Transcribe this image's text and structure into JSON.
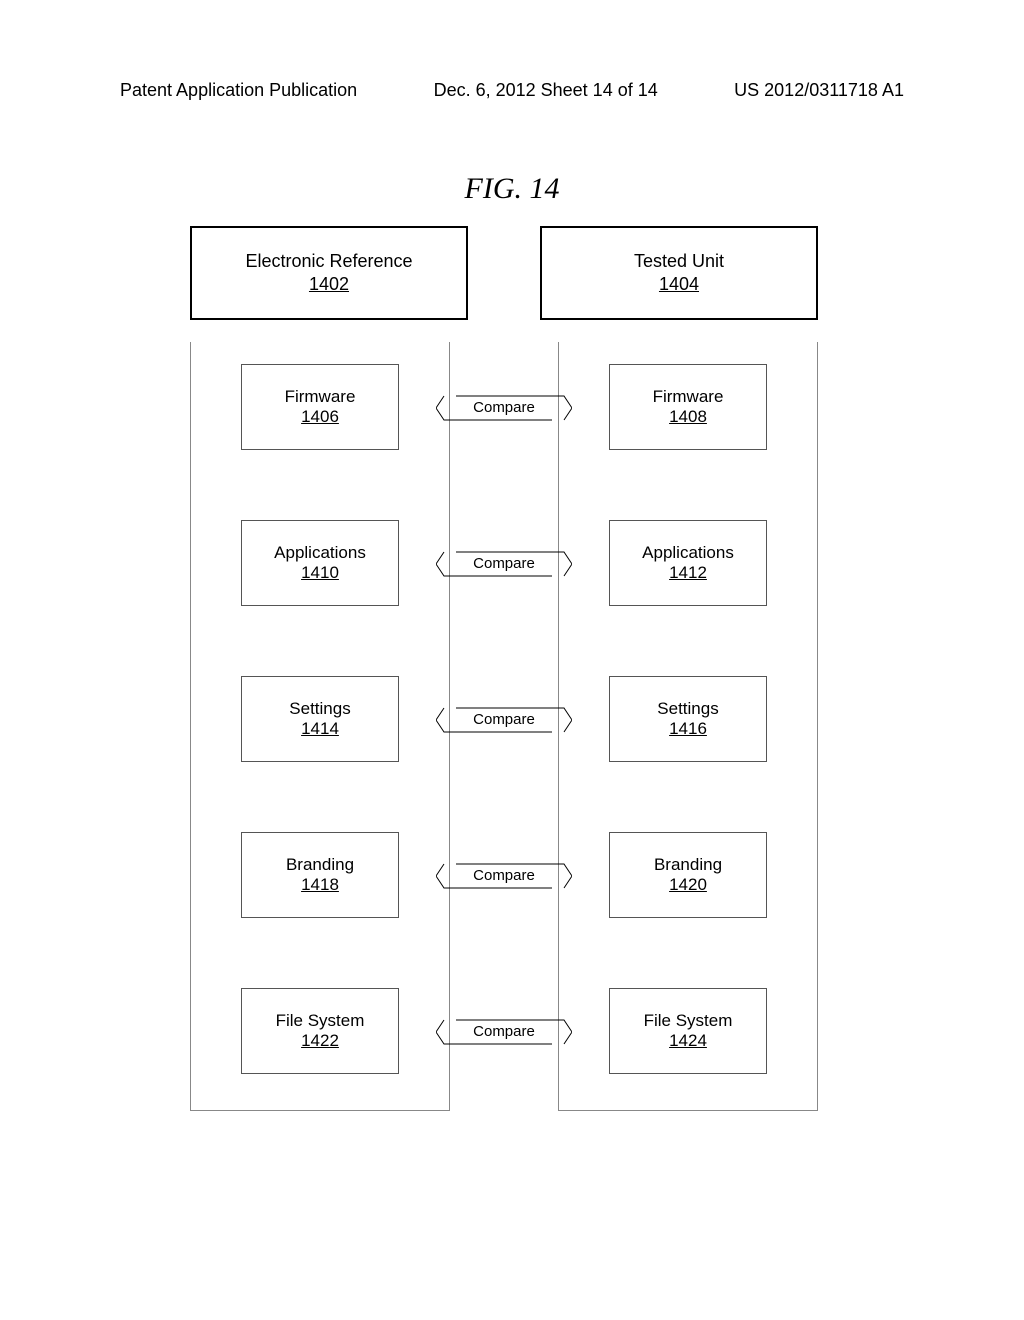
{
  "header": {
    "left": "Patent Application Publication",
    "mid": "Dec. 6, 2012  Sheet 14 of 14",
    "right": "US 2012/0311718 A1"
  },
  "figure": {
    "title": "FIG. 14"
  },
  "columns": {
    "left": {
      "title": "Electronic Reference",
      "ref": "1402"
    },
    "right": {
      "title": "Tested Unit",
      "ref": "1404"
    }
  },
  "rows": [
    {
      "left_label": "Firmware",
      "left_ref": "1406",
      "right_label": "Firmware",
      "right_ref": "1408",
      "compare": "Compare"
    },
    {
      "left_label": "Applications",
      "left_ref": "1410",
      "right_label": "Applications",
      "right_ref": "1412",
      "compare": "Compare"
    },
    {
      "left_label": "Settings",
      "left_ref": "1414",
      "right_label": "Settings",
      "right_ref": "1416",
      "compare": "Compare"
    },
    {
      "left_label": "Branding",
      "left_ref": "1418",
      "right_label": "Branding",
      "right_ref": "1420",
      "compare": "Compare"
    },
    {
      "left_label": "File System",
      "left_ref": "1422",
      "right_label": "File System",
      "right_ref": "1424",
      "compare": "Compare"
    }
  ]
}
